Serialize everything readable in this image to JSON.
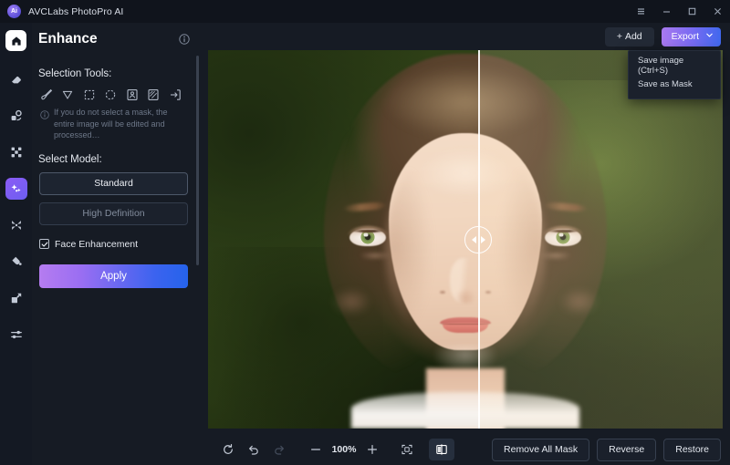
{
  "titlebar": {
    "app_name": "AVCLabs PhotoPro AI",
    "logo_text": "Ai",
    "controls": [
      {
        "name": "menu-button",
        "glyph": "menu"
      },
      {
        "name": "minimize-button",
        "glyph": "minimize"
      },
      {
        "name": "maximize-button",
        "glyph": "maximize"
      },
      {
        "name": "close-button",
        "glyph": "close"
      }
    ]
  },
  "rail": {
    "items": [
      {
        "name": "home",
        "icon": "home-icon",
        "active": false
      },
      {
        "name": "erase",
        "icon": "eraser-icon",
        "active": false
      },
      {
        "name": "object-removal",
        "icon": "object-removal-icon",
        "active": false
      },
      {
        "name": "background",
        "icon": "background-icon",
        "active": false
      },
      {
        "name": "enhance",
        "icon": "enhance-wand-icon",
        "active": true
      },
      {
        "name": "upscale",
        "icon": "upscale-icon",
        "active": false
      },
      {
        "name": "colorize",
        "icon": "paint-drop-icon",
        "active": false
      },
      {
        "name": "resize",
        "icon": "resize-icon",
        "active": false
      },
      {
        "name": "adjust",
        "icon": "sliders-icon",
        "active": false
      }
    ]
  },
  "panel": {
    "title": "Enhance",
    "info_tooltip": "info-icon",
    "selection_tools_label": "Selection Tools:",
    "tools": [
      {
        "name": "brush-tool",
        "icon": "brush-icon"
      },
      {
        "name": "lasso-tool",
        "icon": "pointer-icon"
      },
      {
        "name": "rectangle-select-tool",
        "icon": "dashed-square-icon"
      },
      {
        "name": "ellipse-select-tool",
        "icon": "dashed-circle-icon"
      },
      {
        "name": "portrait-select-tool",
        "icon": "portrait-box-icon"
      },
      {
        "name": "pattern-select-tool",
        "icon": "hatched-box-icon"
      },
      {
        "name": "import-mask-tool",
        "icon": "arrow-into-box-icon"
      }
    ],
    "hint": "If you do not select a mask, the entire image will be edited and processed…",
    "select_model_label": "Select Model:",
    "models": [
      {
        "name": "standard",
        "label": "Standard",
        "selected": true
      },
      {
        "name": "high-definition",
        "label": "High Definition",
        "selected": false
      }
    ],
    "face_enhancement": {
      "label": "Face Enhancement",
      "checked": true,
      "check_glyph": "✓"
    },
    "apply_label": "Apply"
  },
  "actionbar": {
    "add_label": "+ Add",
    "add_plus": "+",
    "add_text": "Add",
    "export_label": "Export",
    "export_menu": [
      {
        "name": "save-image",
        "label": "Save image (Ctrl+S)"
      },
      {
        "name": "save-as-mask",
        "label": "Save as Mask"
      }
    ]
  },
  "bottombar": {
    "zoom_level": "100%",
    "tools": [
      {
        "name": "reset-button",
        "icon": "refresh-icon",
        "state": "enabled"
      },
      {
        "name": "undo-button",
        "icon": "undo-icon",
        "state": "enabled"
      },
      {
        "name": "redo-button",
        "icon": "redo-icon",
        "state": "disabled"
      },
      {
        "name": "zoom-out-button",
        "icon": "minus-icon",
        "state": "enabled"
      },
      {
        "name": "zoom-in-button",
        "icon": "plus-icon",
        "state": "enabled"
      },
      {
        "name": "fit-screen-button",
        "icon": "fit-frame-icon",
        "state": "enabled"
      },
      {
        "name": "compare-button",
        "icon": "split-compare-icon",
        "state": "active"
      }
    ],
    "mask_buttons": [
      {
        "name": "remove-all-mask-button",
        "label": "Remove All Mask"
      },
      {
        "name": "reverse-button",
        "label": "Reverse"
      },
      {
        "name": "restore-button",
        "label": "Restore"
      }
    ]
  },
  "canvas": {
    "subject": "portrait of a young girl with short brown bob hair and green eyes on blurred green outdoor background",
    "split_position_percent": 52.5,
    "handle_icon": "split-slider-handle"
  },
  "colors": {
    "window_bg": "#161b24",
    "titlebar_bg": "#10141c",
    "rail_bg": "#141923",
    "accent_purple": "#8b5cf6",
    "accent_blue": "#2563eb",
    "text_primary": "#e3e7ee",
    "text_muted": "#6d7788"
  }
}
